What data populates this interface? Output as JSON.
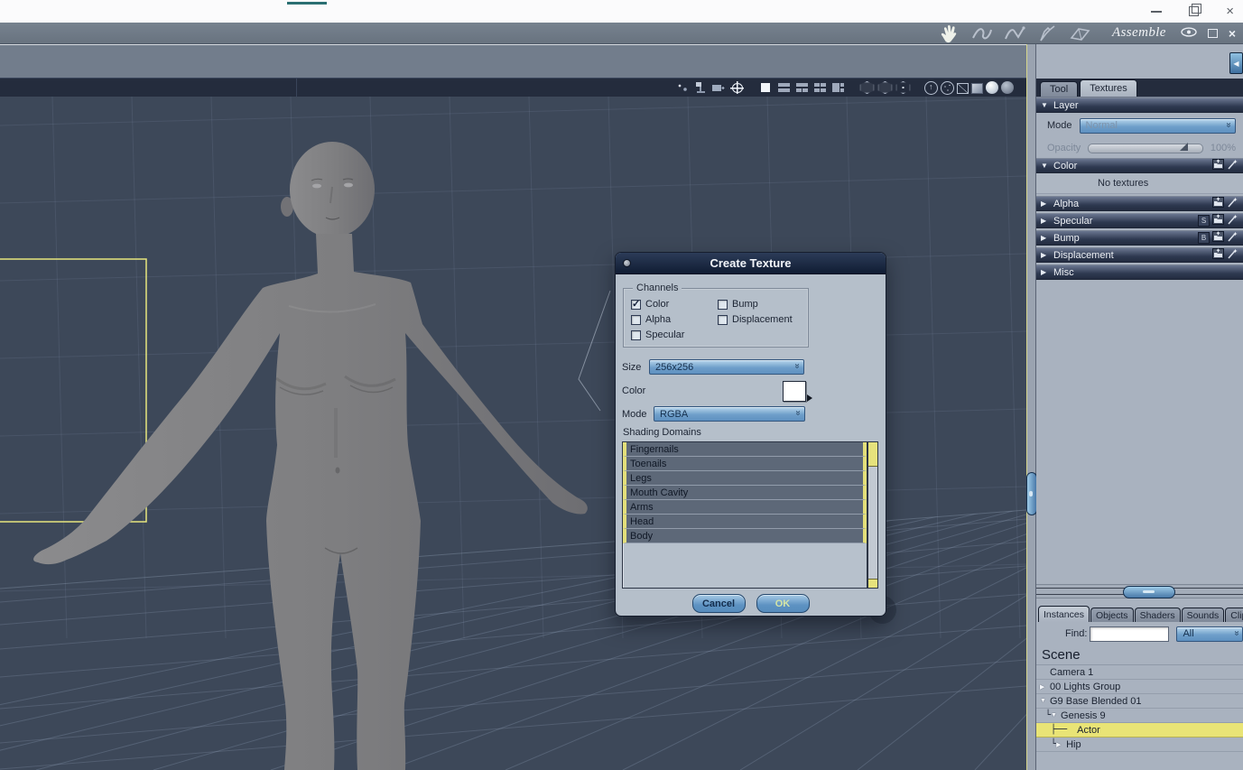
{
  "glyphs": {
    "close": "×",
    "collapse_left": "◀",
    "tri_down": "▼",
    "tri_right": "▶"
  },
  "os_titlebar": {
    "accent_color": "#2a6f72"
  },
  "app_toolbar": {
    "mode_label": "Assemble",
    "tools": [
      {
        "icon": "hand-tool-icon",
        "active": true
      },
      {
        "icon": "soft-move-tool-icon",
        "active": false
      },
      {
        "icon": "curve-tool-icon",
        "active": false
      },
      {
        "icon": "pen-tool-icon",
        "active": false
      },
      {
        "icon": "plane-tool-icon",
        "active": false
      }
    ]
  },
  "viewport": {
    "toolbar_icons": [
      "lights",
      "scene-graph",
      "camera",
      "manipulator",
      "layout-single",
      "layout-two-rows",
      "layout-three-panes",
      "layout-four-grid",
      "layout-one-plus-two",
      "display-box",
      "display-wireframe",
      "display-flat",
      "show-normals",
      "show-points",
      "wire-cube",
      "solid-cube",
      "smooth-sphere",
      "textured-sphere"
    ]
  },
  "right_panel": {
    "tabs": [
      {
        "label": "Tool",
        "active": false
      },
      {
        "label": "Textures",
        "active": true
      }
    ],
    "layer": {
      "title": "Layer",
      "mode_label": "Mode",
      "mode_value": "Normal",
      "opacity_label": "Opacity",
      "opacity_value": "100%"
    },
    "color_section": {
      "label": "Color",
      "empty_text": "No textures"
    },
    "collapsed_sections": [
      {
        "label": "Alpha",
        "badge": "",
        "icons": true
      },
      {
        "label": "Specular",
        "badge": "S",
        "icons": true
      },
      {
        "label": "Bump",
        "badge": "B",
        "icons": true
      },
      {
        "label": "Displacement",
        "badge": "",
        "icons": true
      },
      {
        "label": "Misc",
        "badge": "",
        "icons": false
      }
    ]
  },
  "scene_panel": {
    "tabs": [
      {
        "label": "Instances",
        "active": true
      },
      {
        "label": "Objects",
        "active": false
      },
      {
        "label": "Shaders",
        "active": false
      },
      {
        "label": "Sounds",
        "active": false
      },
      {
        "label": "Clips",
        "active": false
      }
    ],
    "find_label": "Find:",
    "find_value": "",
    "filter_value": "All",
    "header": "Scene",
    "tree": [
      {
        "prefix": "",
        "arrow": "",
        "label": "Camera 1",
        "selected": false
      },
      {
        "prefix": "",
        "arrow": "right",
        "label": "00 Lights Group",
        "selected": false
      },
      {
        "prefix": "",
        "arrow": "down",
        "label": "G9 Base Blended 01",
        "selected": false
      },
      {
        "prefix": " └",
        "arrow": "down",
        "label": "Genesis 9",
        "selected": false
      },
      {
        "prefix": "  ├──",
        "arrow": "",
        "label": "Actor",
        "selected": true
      },
      {
        "prefix": "  └",
        "arrow": "right",
        "label": "Hip",
        "selected": false
      }
    ]
  },
  "dialog": {
    "title": "Create Texture",
    "channels_label": "Channels",
    "channels": [
      {
        "label": "Color",
        "checked": true
      },
      {
        "label": "Bump",
        "checked": false
      },
      {
        "label": "Alpha",
        "checked": false
      },
      {
        "label": "Displacement",
        "checked": false
      },
      {
        "label": "Specular",
        "checked": false
      }
    ],
    "size_label": "Size",
    "size_value": "256x256",
    "color_label": "Color",
    "mode_label": "Mode",
    "mode_value": "RGBA",
    "domains_label": "Shading Domains",
    "domains": [
      "Fingernails",
      "Toenails",
      "Legs",
      "Mouth Cavity",
      "Arms",
      "Head",
      "Body"
    ],
    "cancel_label": "Cancel",
    "ok_label": "OK"
  },
  "colors": {
    "selection_yellow": "#e8e276",
    "dropdown_blue": "#6699c4",
    "viewport_bg": "#3d4859",
    "dialog_title_bg": "#16233a"
  }
}
